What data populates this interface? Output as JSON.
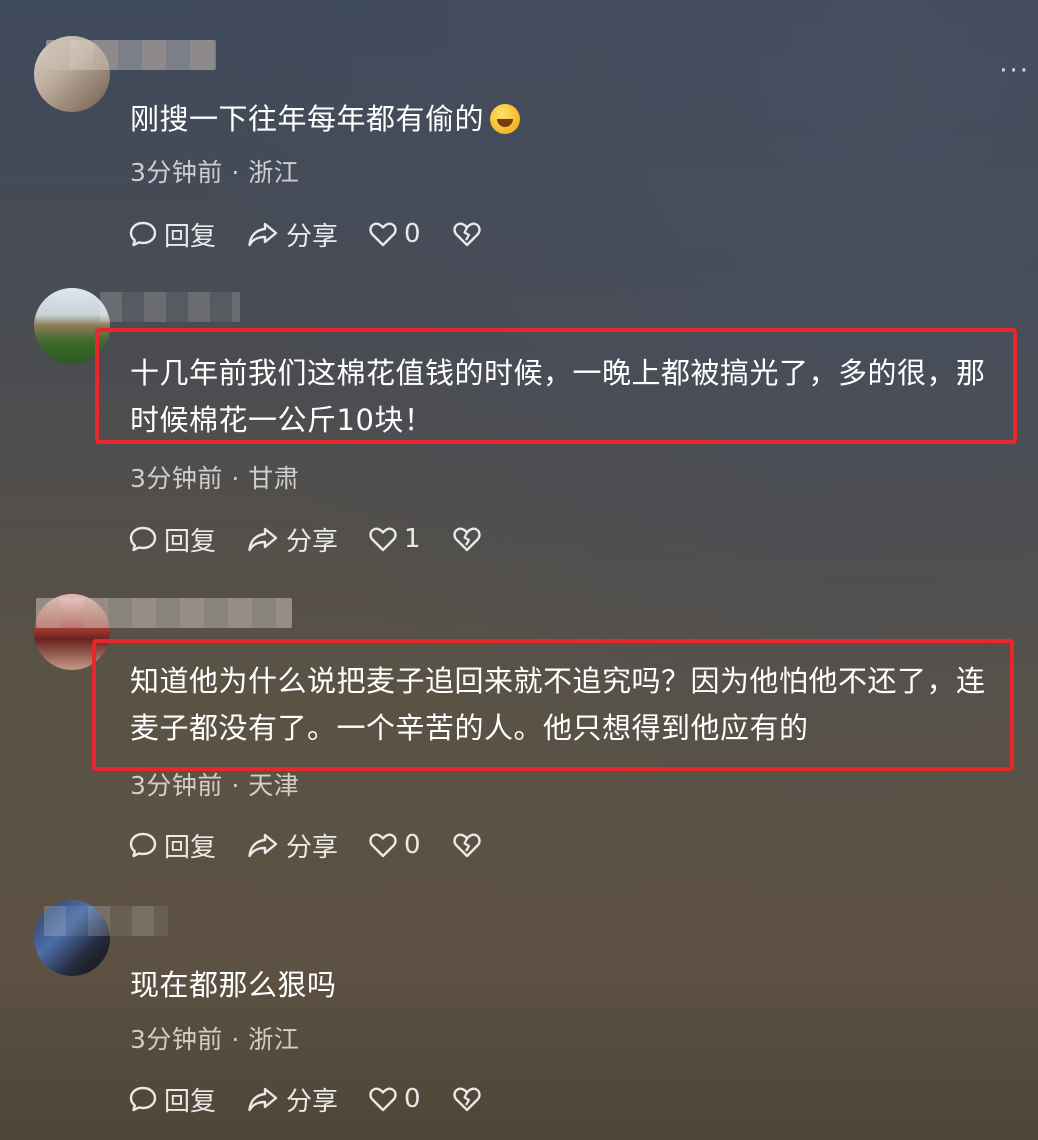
{
  "more_label": "···",
  "actions": {
    "reply": "回复",
    "share": "分享"
  },
  "comments": [
    {
      "text": "刚搜一下往年每年都有偷的",
      "emoji": "rolling-on-floor-laughing",
      "time": "3分钟前",
      "location": "浙江",
      "meta": "3分钟前 · 浙江",
      "likes": "0"
    },
    {
      "text": "十几年前我们这棉花值钱的时候，一晚上都被搞光了，多的很，那时候棉花一公斤10块！",
      "time": "3分钟前",
      "location": "甘肃",
      "meta": "3分钟前 · 甘肃",
      "likes": "1",
      "highlighted": true
    },
    {
      "text": "知道他为什么说把麦子追回来就不追究吗？因为他怕他不还了，连麦子都没有了。一个辛苦的人。他只想得到他应有的",
      "time": "3分钟前",
      "location": "天津",
      "meta": "3分钟前 · 天津",
      "likes": "0",
      "highlighted": true
    },
    {
      "text": "现在都那么狠吗",
      "time": "3分钟前",
      "location": "浙江",
      "meta": "3分钟前 · 浙江",
      "likes": "0"
    }
  ],
  "colors": {
    "highlight": "#e8262b",
    "text": "#ffffff",
    "meta": "#c8c6c2"
  },
  "icons": [
    "speech-bubble-icon",
    "share-arrow-icon",
    "heart-icon",
    "broken-heart-icon",
    "more-dots-icon"
  ]
}
